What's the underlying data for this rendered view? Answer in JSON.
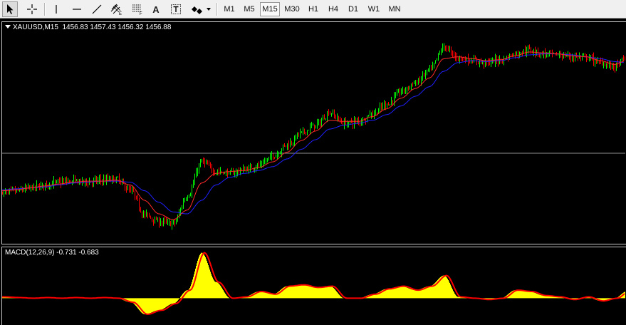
{
  "toolbar": {
    "tools": [
      {
        "icon": "cursor-icon",
        "active": true
      },
      {
        "icon": "crosshair-icon",
        "active": false
      },
      {
        "icon": "vertical-line-icon",
        "active": false
      },
      {
        "icon": "horizontal-line-icon",
        "active": false
      },
      {
        "icon": "trendline-icon",
        "active": false
      },
      {
        "icon": "equidistant-channel-icon",
        "active": false
      },
      {
        "icon": "fibonacci-icon",
        "active": false
      },
      {
        "icon": "text-icon",
        "label": "A",
        "active": false
      },
      {
        "icon": "text-label-icon",
        "active": false
      },
      {
        "icon": "arrows-icon",
        "active": false
      }
    ],
    "timeframes": [
      {
        "label": "M1",
        "active": false
      },
      {
        "label": "M5",
        "active": false
      },
      {
        "label": "M15",
        "active": true
      },
      {
        "label": "M30",
        "active": false
      },
      {
        "label": "H1",
        "active": false
      },
      {
        "label": "H4",
        "active": false
      },
      {
        "label": "D1",
        "active": false
      },
      {
        "label": "W1",
        "active": false
      },
      {
        "label": "MN",
        "active": false
      }
    ]
  },
  "chart": {
    "symbol_label": "XAUUSD,M15",
    "ohlc_label": "1456.83 1457.43 1456.32 1456.88",
    "colors": {
      "background": "#000000",
      "bull": "#00ff00",
      "bear": "#ff0000",
      "ma_fast": "#ff2a2a",
      "ma_slow": "#2020ff",
      "crosshair": "#c0c0c0"
    }
  },
  "macd": {
    "label": "MACD(12,26,9) -0.731 -0.683",
    "colors": {
      "histogram": "#ffff00",
      "signal": "#ff0000"
    }
  },
  "chart_data": {
    "type": "line",
    "x": [
      0,
      20,
      40,
      60,
      80,
      100,
      120,
      140,
      160,
      180,
      200,
      220,
      240,
      260,
      280,
      300,
      320,
      340,
      360,
      380,
      400,
      420,
      440,
      460,
      480,
      500,
      520,
      540,
      560,
      580,
      600,
      620,
      640,
      660,
      680,
      700,
      720,
      740,
      760,
      780,
      800,
      820,
      840,
      860,
      876
    ],
    "series": [
      {
        "values": [
          1455.8,
          1456.0,
          1456.3,
          1456.6,
          1456.9,
          1457.0,
          1456.9,
          1457.1,
          1457.2,
          1456.0,
          1453.5,
          1452.8,
          1452.6,
          1455.5,
          1459.0,
          1458.0,
          1457.8,
          1458.2,
          1458.6,
          1459.6,
          1460.8,
          1462.0,
          1462.8,
          1464.1,
          1463.0,
          1463.2,
          1464.0,
          1465.0,
          1466.3,
          1467.2,
          1468.5,
          1470.9,
          1469.8,
          1469.5,
          1469.3,
          1469.6,
          1470.2,
          1470.6,
          1470.2,
          1470.1,
          1469.9,
          1469.8,
          1469.3,
          1468.9,
          1469.8
        ]
      },
      {
        "values": [
          1456.0,
          1456.1,
          1456.3,
          1456.5,
          1456.7,
          1456.9,
          1457.0,
          1457.0,
          1457.1,
          1456.6,
          1455.0,
          1453.6,
          1453.0,
          1454.0,
          1456.8,
          1457.8,
          1458.0,
          1458.1,
          1458.4,
          1459.0,
          1460.0,
          1461.2,
          1462.2,
          1463.3,
          1463.2,
          1463.2,
          1463.7,
          1464.5,
          1465.6,
          1466.6,
          1467.7,
          1469.7,
          1469.9,
          1469.7,
          1469.5,
          1469.6,
          1470.0,
          1470.4,
          1470.3,
          1470.2,
          1470.0,
          1469.9,
          1469.5,
          1469.1,
          1469.5
        ]
      },
      {
        "values": [
          1456.1,
          1456.2,
          1456.3,
          1456.4,
          1456.6,
          1456.8,
          1456.9,
          1457.0,
          1457.0,
          1456.9,
          1456.0,
          1454.8,
          1453.8,
          1453.6,
          1455.0,
          1456.6,
          1457.4,
          1457.8,
          1458.1,
          1458.5,
          1459.3,
          1460.3,
          1461.3,
          1462.4,
          1462.8,
          1463.0,
          1463.3,
          1463.9,
          1464.8,
          1465.8,
          1466.8,
          1468.4,
          1469.3,
          1469.5,
          1469.4,
          1469.5,
          1469.8,
          1470.1,
          1470.2,
          1470.2,
          1470.1,
          1469.9,
          1469.7,
          1469.4,
          1469.3
        ]
      },
      {
        "values": [
          0.1,
          0.05,
          0.0,
          0.05,
          0.0,
          0.05,
          0.0,
          0.05,
          0.0,
          -0.3,
          -1.2,
          -0.9,
          -0.4,
          0.6,
          3.4,
          1.2,
          0.0,
          0.1,
          0.5,
          0.3,
          0.9,
          1.0,
          0.8,
          0.9,
          0.0,
          0.0,
          0.3,
          0.7,
          0.9,
          0.6,
          0.9,
          1.7,
          0.1,
          0.0,
          -0.1,
          0.0,
          0.6,
          0.5,
          0.2,
          0.1,
          -0.1,
          0.1,
          -0.2,
          0.0,
          0.5
        ]
      }
    ]
  }
}
